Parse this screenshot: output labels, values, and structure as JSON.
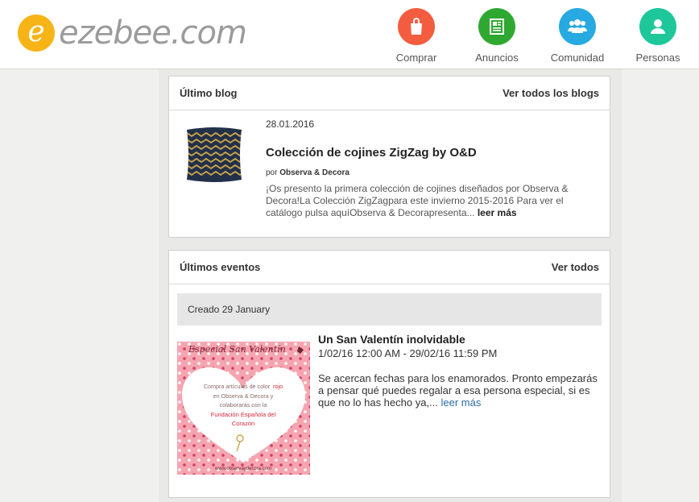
{
  "brand": {
    "logo_letter": "e",
    "name": "ezebee.com",
    "logo_color": "#f6b417"
  },
  "nav": [
    {
      "label": "Comprar",
      "icon": "shopping-bag-icon",
      "color": "#f35c3f"
    },
    {
      "label": "Anuncios",
      "icon": "newspaper-icon",
      "color": "#2fa831"
    },
    {
      "label": "Comunidad",
      "icon": "community-icon",
      "color": "#27a9e1"
    },
    {
      "label": "Personas",
      "icon": "person-icon",
      "color": "#1ec79a"
    }
  ],
  "blog": {
    "heading": "Último blog",
    "view_all": "Ver todos los blogs",
    "date": "28.01.2016",
    "title": "Colección de cojines ZigZag by O&D",
    "by_prefix": "por",
    "author": "Observa & Decora",
    "excerpt": "¡Os presento la primera colección de cojines diseñados por Observa & Decora!La Colección ZigZagpara este invierno 2015-2016 Para ver el catálogo pulsa aquíObserva & Decorapresenta...",
    "read_more": "leer más"
  },
  "events": {
    "heading": "Últimos eventos",
    "view_all": "Ver todos",
    "created": "Creado 29 January",
    "title": "Un San Valentín inolvidable",
    "dates": "1/02/16 12:00 AM - 29/02/16 11:59 PM",
    "excerpt": "Se acercan fechas para los enamorados. Pronto empezarás a pensar qué puedes regalar a esa persona especial, si es que no lo has hecho ya,...",
    "read_more": "leer más",
    "image": {
      "heading": "Especial San Valentín",
      "line1": "Compra artículos de color",
      "line1_accent": "rojo",
      "line2": "en Observa & Decora y",
      "line3": "colaborarás con la",
      "line4": "Fundación Española del",
      "line5": "Corazón",
      "footer": "www.observaydecora.com"
    }
  }
}
